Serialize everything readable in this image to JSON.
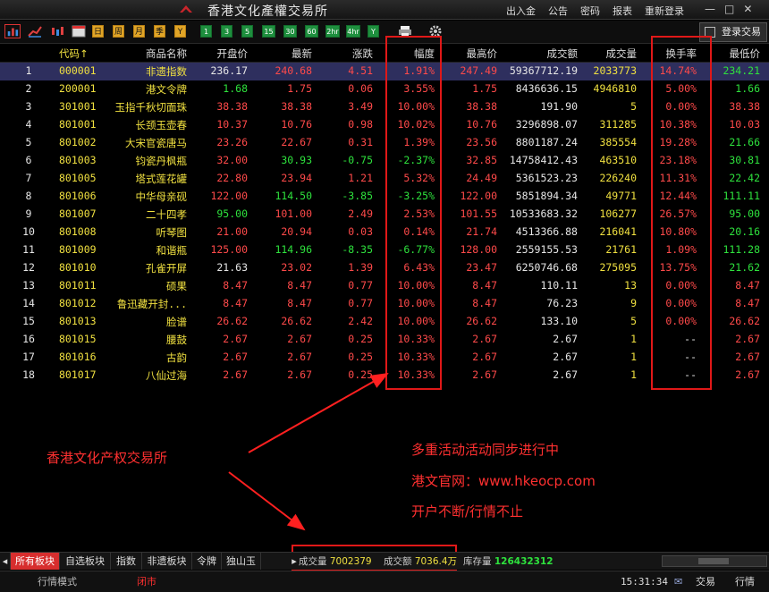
{
  "app": {
    "title": "香港文化產權交易所",
    "menu": [
      "出入金",
      "公告",
      "密码",
      "报表",
      "重新登录"
    ],
    "window_controls": [
      "—",
      "□",
      "✕"
    ]
  },
  "toolbar": {
    "periods": [
      "日",
      "周",
      "月",
      "季",
      "Y"
    ],
    "intervals": [
      "1",
      "3",
      "5",
      "15",
      "30",
      "60",
      "2hr",
      "4hr",
      "Y"
    ],
    "login_label": "登录交易"
  },
  "table": {
    "columns": [
      "",
      "代码↑",
      "商品名称",
      "开盘价",
      "最新",
      "涨跌",
      "幅度",
      "最高价",
      "成交额",
      "成交量",
      "换手率",
      "最低价"
    ],
    "rows": [
      {
        "no": "1",
        "code": "000001",
        "name": "非遗指数",
        "open": "236.17",
        "last": "240.68",
        "chg": "4.51",
        "pct": "1.91%",
        "high": "247.49",
        "amount": "59367712.19",
        "vol": "2033773",
        "turn": "14.74%",
        "low": "234.21"
      },
      {
        "no": "2",
        "code": "200001",
        "name": "港文令牌",
        "open": "1.68",
        "last": "1.75",
        "chg": "0.06",
        "pct": "3.55%",
        "high": "1.75",
        "amount": "8436636.15",
        "vol": "4946810",
        "turn": "5.00%",
        "low": "1.66"
      },
      {
        "no": "3",
        "code": "301001",
        "name": "玉指千秋切面珠",
        "open": "38.38",
        "last": "38.38",
        "chg": "3.49",
        "pct": "10.00%",
        "high": "38.38",
        "amount": "191.90",
        "vol": "5",
        "turn": "0.00%",
        "low": "38.38"
      },
      {
        "no": "4",
        "code": "801001",
        "name": "长颈玉壶春",
        "open": "10.37",
        "last": "10.76",
        "chg": "0.98",
        "pct": "10.02%",
        "high": "10.76",
        "amount": "3296898.07",
        "vol": "311285",
        "turn": "10.38%",
        "low": "10.03"
      },
      {
        "no": "5",
        "code": "801002",
        "name": "大宋官瓷唐马",
        "open": "23.26",
        "last": "22.67",
        "chg": "0.31",
        "pct": "1.39%",
        "high": "23.56",
        "amount": "8801187.24",
        "vol": "385554",
        "turn": "19.28%",
        "low": "21.66"
      },
      {
        "no": "6",
        "code": "801003",
        "name": "钧瓷丹枫瓶",
        "open": "32.00",
        "last": "30.93",
        "chg": "-0.75",
        "pct": "-2.37%",
        "high": "32.85",
        "amount": "14758412.43",
        "vol": "463510",
        "turn": "23.18%",
        "low": "30.81"
      },
      {
        "no": "7",
        "code": "801005",
        "name": "塔式莲花罐",
        "open": "22.80",
        "last": "23.94",
        "chg": "1.21",
        "pct": "5.32%",
        "high": "24.49",
        "amount": "5361523.23",
        "vol": "226240",
        "turn": "11.31%",
        "low": "22.42"
      },
      {
        "no": "8",
        "code": "801006",
        "name": "中华母亲砚",
        "open": "122.00",
        "last": "114.50",
        "chg": "-3.85",
        "pct": "-3.25%",
        "high": "122.00",
        "amount": "5851894.34",
        "vol": "49771",
        "turn": "12.44%",
        "low": "111.11"
      },
      {
        "no": "9",
        "code": "801007",
        "name": "二十四孝",
        "open": "95.00",
        "last": "101.00",
        "chg": "2.49",
        "pct": "2.53%",
        "high": "101.55",
        "amount": "10533683.32",
        "vol": "106277",
        "turn": "26.57%",
        "low": "95.00"
      },
      {
        "no": "10",
        "code": "801008",
        "name": "听琴图",
        "open": "21.00",
        "last": "20.94",
        "chg": "0.03",
        "pct": "0.14%",
        "high": "21.74",
        "amount": "4513366.88",
        "vol": "216041",
        "turn": "10.80%",
        "low": "20.16"
      },
      {
        "no": "11",
        "code": "801009",
        "name": "和谐瓶",
        "open": "125.00",
        "last": "114.96",
        "chg": "-8.35",
        "pct": "-6.77%",
        "high": "128.00",
        "amount": "2559155.53",
        "vol": "21761",
        "turn": "1.09%",
        "low": "111.28"
      },
      {
        "no": "12",
        "code": "801010",
        "name": "孔雀开屏",
        "open": "21.63",
        "last": "23.02",
        "chg": "1.39",
        "pct": "6.43%",
        "high": "23.47",
        "amount": "6250746.68",
        "vol": "275095",
        "turn": "13.75%",
        "low": "21.62"
      },
      {
        "no": "13",
        "code": "801011",
        "name": "硕果",
        "open": "8.47",
        "last": "8.47",
        "chg": "0.77",
        "pct": "10.00%",
        "high": "8.47",
        "amount": "110.11",
        "vol": "13",
        "turn": "0.00%",
        "low": "8.47"
      },
      {
        "no": "14",
        "code": "801012",
        "name": "鲁迅藏开封...",
        "open": "8.47",
        "last": "8.47",
        "chg": "0.77",
        "pct": "10.00%",
        "high": "8.47",
        "amount": "76.23",
        "vol": "9",
        "turn": "0.00%",
        "low": "8.47"
      },
      {
        "no": "15",
        "code": "801013",
        "name": "脸谱",
        "open": "26.62",
        "last": "26.62",
        "chg": "2.42",
        "pct": "10.00%",
        "high": "26.62",
        "amount": "133.10",
        "vol": "5",
        "turn": "0.00%",
        "low": "26.62"
      },
      {
        "no": "16",
        "code": "801015",
        "name": "腰鼓",
        "open": "2.67",
        "last": "2.67",
        "chg": "0.25",
        "pct": "10.33%",
        "high": "2.67",
        "amount": "2.67",
        "vol": "1",
        "turn": "--",
        "low": "2.67"
      },
      {
        "no": "17",
        "code": "801016",
        "name": "古韵",
        "open": "2.67",
        "last": "2.67",
        "chg": "0.25",
        "pct": "10.33%",
        "high": "2.67",
        "amount": "2.67",
        "vol": "1",
        "turn": "--",
        "low": "2.67"
      },
      {
        "no": "18",
        "code": "801017",
        "name": "八仙过海",
        "open": "2.67",
        "last": "2.67",
        "chg": "0.25",
        "pct": "10.33%",
        "high": "2.67",
        "amount": "2.67",
        "vol": "1",
        "turn": "--",
        "low": "2.67"
      }
    ]
  },
  "annotations": {
    "left": "香港文化产权交易所",
    "right_lines": [
      "多重活动活动同步进行中",
      "港文官网：www.hkeocp.com",
      "开户不断/行情不止"
    ]
  },
  "tabs": [
    "所有板块",
    "自选板块",
    "指数",
    "非遗板块",
    "令牌",
    "独山玉"
  ],
  "stats": {
    "vol_label": "成交量",
    "vol_value": "7002379",
    "amt_label": "成交额",
    "amt_value": "7036.4万",
    "stock_label": "库存量",
    "stock_value": "126432312"
  },
  "status": {
    "mode": "行情模式",
    "market": "闭市",
    "time": "15:31:34",
    "trade": "交易",
    "quote": "行情"
  },
  "colors": {
    "up": "#ff4a4a",
    "down": "#2ee23d",
    "code": "#f0e040",
    "selected_row": "#2e2f5e",
    "highlight": "#e01818"
  }
}
